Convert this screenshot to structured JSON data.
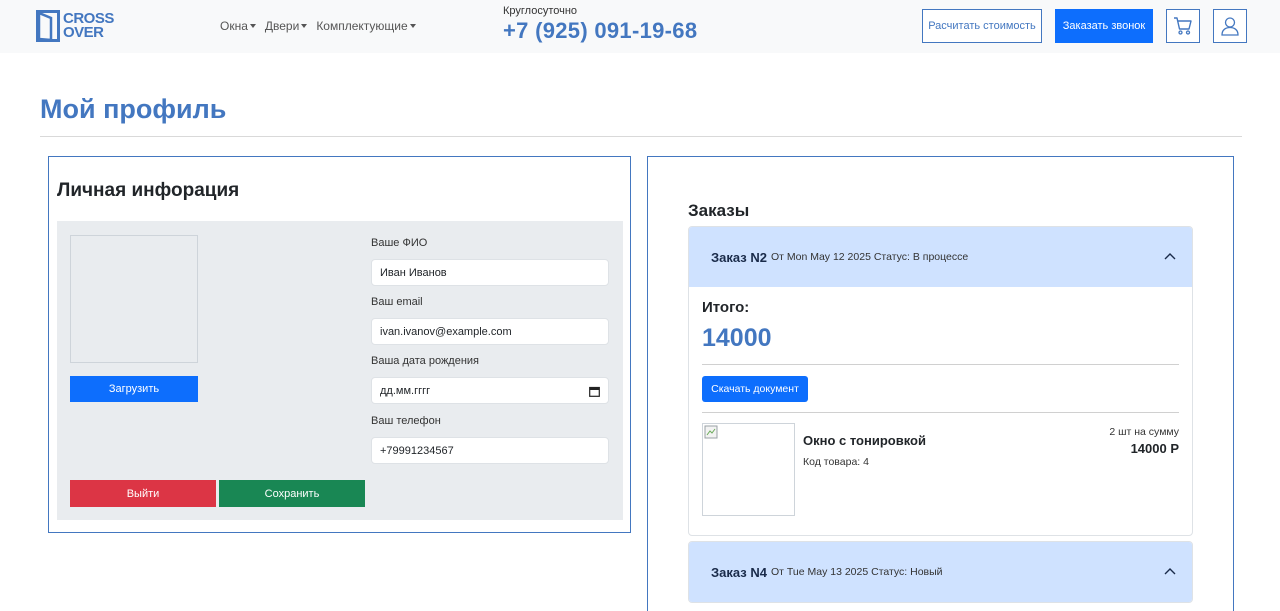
{
  "header": {
    "logo": {
      "line1": "CROSS",
      "line2": "OVER"
    },
    "nav": [
      {
        "label": "Окна"
      },
      {
        "label": "Двери"
      },
      {
        "label": "Комплектующие"
      }
    ],
    "phone_caption": "Круглосуточно",
    "phone": "+7 (925) 091-19-68",
    "calc_button": "Расчитать стоимость",
    "call_button": "Заказать звонок"
  },
  "page": {
    "title": "Мой профиль"
  },
  "profile": {
    "title": "Личная инфорация",
    "upload_button": "Загрузить",
    "fields": {
      "name_label": "Ваше ФИО",
      "name_value": "Иван Иванов",
      "email_label": "Ваш email",
      "email_value": "ivan.ivanov@example.com",
      "birth_label": "Ваша дата рождения",
      "birth_value": "дд.мм.гггг",
      "phone_label": "Ваш телефон",
      "phone_value": "+79991234567"
    },
    "logout_button": "Выйти",
    "save_button": "Сохранить"
  },
  "orders": {
    "title": "Заказы",
    "list": [
      {
        "name": "Заказ N2",
        "meta": "От Mon May 12 2025  Статус: В процессе",
        "expanded": true,
        "total_label": "Итого:",
        "total_value": "14000",
        "download_button": "Скачать документ",
        "items": [
          {
            "name": "Окно с тонировкой",
            "code": "Код товара: 4",
            "qty": "2 шт на сумму",
            "sum": "14000 Р"
          }
        ]
      },
      {
        "name": "Заказ N4",
        "meta": "От Tue May 13 2025  Статус: Новый",
        "expanded": true
      }
    ]
  },
  "colors": {
    "brand": "#4377c0",
    "primary": "#0d6efd",
    "danger": "#dc3545",
    "success": "#198754",
    "accordion_header": "#cfe2ff",
    "panel": "#e9ecef"
  }
}
